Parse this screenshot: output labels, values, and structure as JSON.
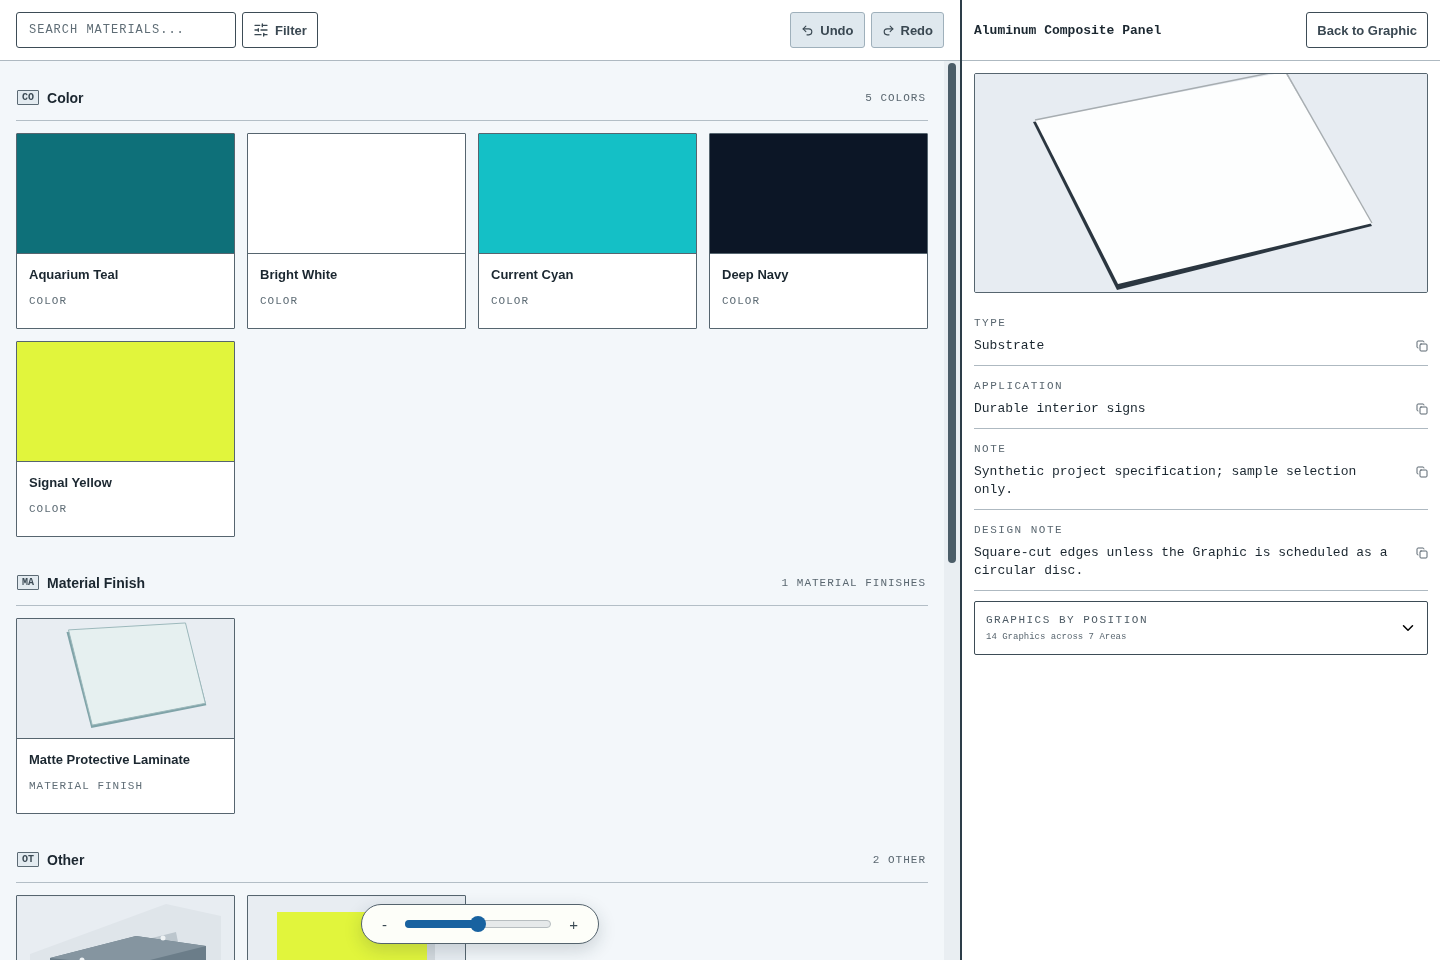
{
  "toolbar": {
    "search": {
      "placeholder": "SEARCH MATERIALS..."
    },
    "filter": "Filter",
    "undo": "Undo",
    "redo": "Redo"
  },
  "sections": [
    {
      "badge": "CO",
      "title": "Color",
      "count": "5 COLORS",
      "items": [
        {
          "kind": "swatch",
          "name": "Aquarium Teal",
          "type": "COLOR",
          "color": "#0e7079"
        },
        {
          "kind": "swatch",
          "name": "Bright White",
          "type": "COLOR",
          "color": "#ffffff"
        },
        {
          "kind": "swatch",
          "name": "Current Cyan",
          "type": "COLOR",
          "color": "#14c0c6"
        },
        {
          "kind": "swatch",
          "name": "Deep Navy",
          "type": "COLOR",
          "color": "#0c1626"
        },
        {
          "kind": "swatch",
          "name": "Signal Yellow",
          "type": "COLOR",
          "color": "#e1f53c"
        }
      ]
    },
    {
      "badge": "MA",
      "title": "Material Finish",
      "count": "1 MATERIAL FINISHES",
      "items": [
        {
          "kind": "picture",
          "name": "Matte Protective Laminate",
          "type": "MATERIAL FINISH"
        }
      ]
    },
    {
      "badge": "OT",
      "title": "Other",
      "count": "2 OTHER"
    }
  ],
  "zoom": {
    "minus": "-",
    "plus": "+",
    "level": 0.5
  },
  "detail": {
    "title": "Aluminum Composite Panel",
    "back": "Back to Graphic",
    "fields": [
      {
        "label": "TYPE",
        "value": "Substrate"
      },
      {
        "label": "APPLICATION",
        "value": "Durable interior signs"
      },
      {
        "label": "NOTE",
        "value": "Synthetic project specification; sample selection only."
      },
      {
        "label": "DESIGN NOTE",
        "value": "Square-cut edges unless the Graphic is scheduled as a circular disc."
      }
    ],
    "accordion": {
      "title": "GRAPHICS BY POSITION",
      "subtitle": "14 Graphics across 7 Areas",
      "expanded": false
    }
  }
}
